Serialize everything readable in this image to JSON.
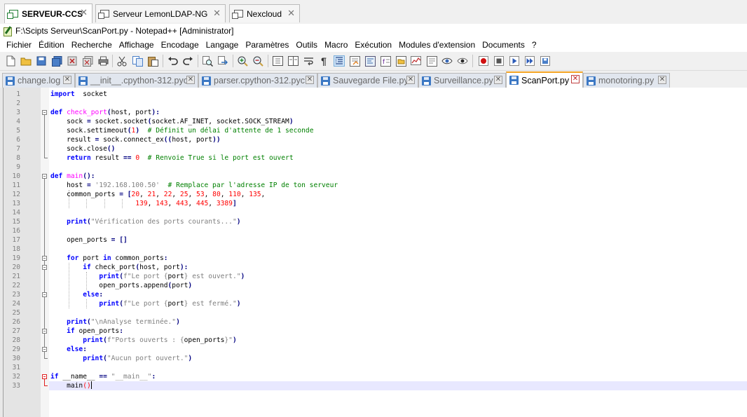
{
  "remote_tabs": [
    {
      "label": "SERVEUR-CCS",
      "active": true,
      "close": "✕"
    },
    {
      "label": "Serveur LemonLDAP-NG",
      "active": false,
      "close": "✕"
    },
    {
      "label": "Nexcloud",
      "active": false,
      "close": "✕"
    }
  ],
  "window": {
    "title": "F:\\Scipts Serveur\\ScanPort.py - Notepad++ [Administrator]"
  },
  "menu": [
    "Fichier",
    "Édition",
    "Recherche",
    "Affichage",
    "Encodage",
    "Langage",
    "Paramètres",
    "Outils",
    "Macro",
    "Exécution",
    "Modules d'extension",
    "Documents",
    "?"
  ],
  "toolbar": {
    "icons": [
      "new-file-icon",
      "open-file-icon",
      "save-icon",
      "save-all-icon",
      "close-icon",
      "close-all-icon",
      "print-icon",
      "cut-icon",
      "copy-icon",
      "paste-icon",
      "undo-icon",
      "redo-icon",
      "find-icon",
      "replace-icon",
      "zoom-in-icon",
      "zoom-out-icon",
      "sync-vertical-icon",
      "sync-horizontal-icon",
      "word-wrap-icon",
      "show-all-chars-icon",
      "indent-guide-icon",
      "udl-icon",
      "doc-map-icon",
      "function-list-icon",
      "folder-workspace-icon",
      "monitoring-icon",
      "record-macro-icon",
      "stop-macro-icon",
      "play-macro-icon",
      "run-macro-multiple-icon",
      "save-macro-icon"
    ]
  },
  "doc_tabs": [
    {
      "label": "change.log",
      "active": false
    },
    {
      "label": "__init__.cpython-312.pyc",
      "active": false
    },
    {
      "label": "parser.cpython-312.pyc",
      "active": false
    },
    {
      "label": "Sauvegarde File.py",
      "active": false
    },
    {
      "label": "Surveillance.py",
      "active": false
    },
    {
      "label": "ScanPort.py",
      "active": true
    },
    {
      "label": "monotoring.py",
      "active": false
    }
  ],
  "editor": {
    "current_line": 33,
    "lines": [
      {
        "n": "1",
        "tokens": [
          [
            "kw",
            "import"
          ],
          [
            "",
            "  socket"
          ]
        ]
      },
      {
        "n": "2",
        "tokens": []
      },
      {
        "n": "3",
        "tokens": [
          [
            "kw",
            "def "
          ],
          [
            "fn",
            "check_port"
          ],
          [
            "op",
            "("
          ],
          [
            "",
            "host, port"
          ],
          [
            "op",
            ")"
          ],
          [
            "op",
            ":"
          ]
        ]
      },
      {
        "n": "4",
        "tokens": [
          [
            "",
            "    sock "
          ],
          [
            "op",
            "="
          ],
          [
            "",
            " socket.socket"
          ],
          [
            "op",
            "("
          ],
          [
            "",
            "socket.AF_INET, socket.SOCK_STREAM"
          ],
          [
            "op",
            ")"
          ]
        ]
      },
      {
        "n": "5",
        "tokens": [
          [
            "",
            "    sock.settimeout"
          ],
          [
            "op",
            "("
          ],
          [
            "num",
            "1"
          ],
          [
            "op",
            ")"
          ],
          [
            "",
            " "
          ],
          [
            "cm",
            " # Définit un délai d'attente de 1 seconde"
          ]
        ]
      },
      {
        "n": "6",
        "tokens": [
          [
            "",
            "    result "
          ],
          [
            "op",
            "="
          ],
          [
            "",
            " sock.connect_ex"
          ],
          [
            "op",
            "(("
          ],
          [
            "",
            "host, port"
          ],
          [
            "op",
            "))"
          ]
        ]
      },
      {
        "n": "7",
        "tokens": [
          [
            "",
            "    sock.close"
          ],
          [
            "op",
            "()"
          ]
        ]
      },
      {
        "n": "8",
        "tokens": [
          [
            "",
            "    "
          ],
          [
            "kw",
            "return"
          ],
          [
            "",
            " result "
          ],
          [
            "op",
            "=="
          ],
          [
            "",
            " "
          ],
          [
            "num",
            "0"
          ],
          [
            "",
            " "
          ],
          [
            "cm",
            " # Renvoie True si le port est ouvert"
          ]
        ]
      },
      {
        "n": "9",
        "tokens": []
      },
      {
        "n": "10",
        "tokens": [
          [
            "kw",
            "def "
          ],
          [
            "fn",
            "main"
          ],
          [
            "op",
            "()"
          ],
          [
            "op",
            ":"
          ]
        ]
      },
      {
        "n": "11",
        "tokens": [
          [
            "",
            "    host "
          ],
          [
            "op",
            "="
          ],
          [
            "",
            " "
          ],
          [
            "str",
            "'192.168.100.50'"
          ],
          [
            "",
            " "
          ],
          [
            "cm",
            " # Remplace par l'adresse IP de ton serveur"
          ]
        ]
      },
      {
        "n": "12",
        "tokens": [
          [
            "",
            "    common_ports "
          ],
          [
            "op",
            "="
          ],
          [
            "",
            " "
          ],
          [
            "op",
            "["
          ],
          [
            "num",
            "20"
          ],
          [
            "",
            ", "
          ],
          [
            "num",
            "21"
          ],
          [
            "",
            ", "
          ],
          [
            "num",
            "22"
          ],
          [
            "",
            ", "
          ],
          [
            "num",
            "25"
          ],
          [
            "",
            ", "
          ],
          [
            "num",
            "53"
          ],
          [
            "",
            ", "
          ],
          [
            "num",
            "80"
          ],
          [
            "",
            ", "
          ],
          [
            "num",
            "110"
          ],
          [
            "",
            ", "
          ],
          [
            "num",
            "135"
          ],
          [
            "",
            ","
          ]
        ]
      },
      {
        "n": "13",
        "tokens": [
          [
            "",
            "                     "
          ],
          [
            "num",
            "139"
          ],
          [
            "",
            ", "
          ],
          [
            "num",
            "143"
          ],
          [
            "",
            ", "
          ],
          [
            "num",
            "443"
          ],
          [
            "",
            ", "
          ],
          [
            "num",
            "445"
          ],
          [
            "",
            ", "
          ],
          [
            "num",
            "3389"
          ],
          [
            "op",
            "]"
          ]
        ]
      },
      {
        "n": "14",
        "tokens": []
      },
      {
        "n": "15",
        "tokens": [
          [
            "",
            "    "
          ],
          [
            "kw",
            "print"
          ],
          [
            "op",
            "("
          ],
          [
            "str",
            "\"Vérification des ports courants...\""
          ],
          [
            "op",
            ")"
          ]
        ]
      },
      {
        "n": "16",
        "tokens": []
      },
      {
        "n": "17",
        "tokens": [
          [
            "",
            "    open_ports "
          ],
          [
            "op",
            "="
          ],
          [
            "",
            " "
          ],
          [
            "op",
            "[]"
          ]
        ]
      },
      {
        "n": "18",
        "tokens": []
      },
      {
        "n": "19",
        "tokens": [
          [
            "",
            "    "
          ],
          [
            "kw",
            "for"
          ],
          [
            "",
            " port "
          ],
          [
            "kw",
            "in"
          ],
          [
            "",
            " common_ports"
          ],
          [
            "op",
            ":"
          ]
        ]
      },
      {
        "n": "20",
        "tokens": [
          [
            "",
            "        "
          ],
          [
            "kw",
            "if"
          ],
          [
            "",
            " check_port"
          ],
          [
            "op",
            "("
          ],
          [
            "",
            "host, port"
          ],
          [
            "op",
            ")"
          ],
          [
            "op",
            ":"
          ]
        ]
      },
      {
        "n": "21",
        "tokens": [
          [
            "",
            "            "
          ],
          [
            "kw",
            "print"
          ],
          [
            "op",
            "("
          ],
          [
            "str",
            "f\"Le port {"
          ],
          [
            "",
            "port"
          ],
          [
            "str",
            "} est ouvert.\""
          ],
          [
            "op",
            ")"
          ]
        ]
      },
      {
        "n": "22",
        "tokens": [
          [
            "",
            "            open_ports.append"
          ],
          [
            "op",
            "("
          ],
          [
            "",
            "port"
          ],
          [
            "op",
            ")"
          ]
        ]
      },
      {
        "n": "23",
        "tokens": [
          [
            "",
            "        "
          ],
          [
            "kw",
            "else"
          ],
          [
            "op",
            ":"
          ]
        ]
      },
      {
        "n": "24",
        "tokens": [
          [
            "",
            "            "
          ],
          [
            "kw",
            "print"
          ],
          [
            "op",
            "("
          ],
          [
            "str",
            "f\"Le port {"
          ],
          [
            "",
            "port"
          ],
          [
            "str",
            "} est fermé.\""
          ],
          [
            "op",
            ")"
          ]
        ]
      },
      {
        "n": "25",
        "tokens": []
      },
      {
        "n": "26",
        "tokens": [
          [
            "",
            "    "
          ],
          [
            "kw",
            "print"
          ],
          [
            "op",
            "("
          ],
          [
            "str",
            "\"\\nAnalyse terminée.\""
          ],
          [
            "op",
            ")"
          ]
        ]
      },
      {
        "n": "27",
        "tokens": [
          [
            "",
            "    "
          ],
          [
            "kw",
            "if"
          ],
          [
            "",
            " open_ports"
          ],
          [
            "op",
            ":"
          ]
        ]
      },
      {
        "n": "28",
        "tokens": [
          [
            "",
            "        "
          ],
          [
            "kw",
            "print"
          ],
          [
            "op",
            "("
          ],
          [
            "str",
            "f\"Ports ouverts : {"
          ],
          [
            "",
            "open_ports"
          ],
          [
            "str",
            "}\""
          ],
          [
            "op",
            ")"
          ]
        ]
      },
      {
        "n": "29",
        "tokens": [
          [
            "",
            "    "
          ],
          [
            "kw",
            "else"
          ],
          [
            "op",
            ":"
          ]
        ]
      },
      {
        "n": "30",
        "tokens": [
          [
            "",
            "        "
          ],
          [
            "kw",
            "print"
          ],
          [
            "op",
            "("
          ],
          [
            "str",
            "\"Aucun port ouvert.\""
          ],
          [
            "op",
            ")"
          ]
        ]
      },
      {
        "n": "31",
        "tokens": []
      },
      {
        "n": "32",
        "tokens": [
          [
            "kw",
            "if"
          ],
          [
            "",
            " __name__ "
          ],
          [
            "op",
            "=="
          ],
          [
            "",
            " "
          ],
          [
            "str",
            "\"__main__\""
          ],
          [
            "op",
            ":"
          ]
        ]
      },
      {
        "n": "33",
        "tokens": [
          [
            "",
            "    main"
          ],
          [
            "bracematch",
            "()"
          ]
        ]
      }
    ]
  }
}
